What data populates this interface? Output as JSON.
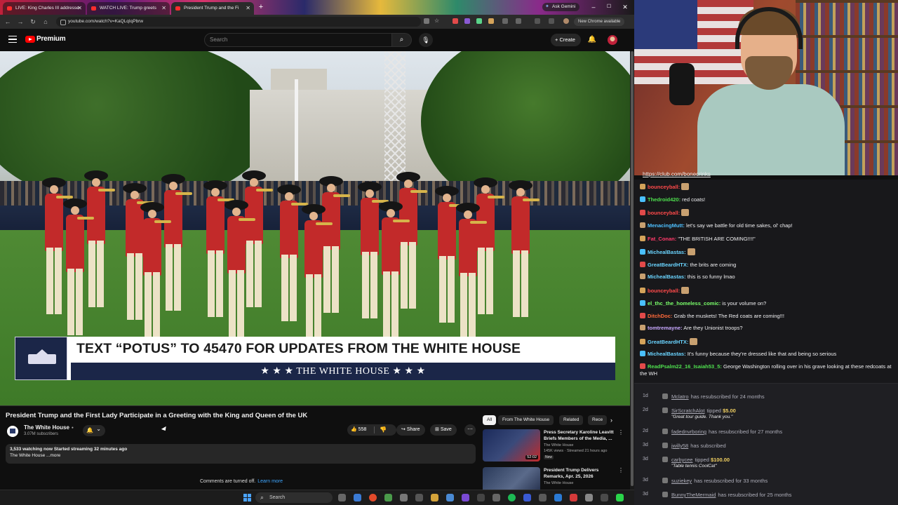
{
  "browser": {
    "tabs": [
      {
        "title": "LIVE: King Charles III addresse",
        "active": false
      },
      {
        "title": "WATCH LIVE: Trump greets",
        "active": false
      },
      {
        "title": "President Trump and the Fi",
        "active": true
      }
    ],
    "ask_gemini": "Ask Gemini",
    "url": "youtube.com/watch?v=KaQLqIqPbrw",
    "new_chrome": "New Chrome available",
    "window_controls": {
      "minimize": "–",
      "maximize": "☐",
      "close": "✕"
    }
  },
  "youtube": {
    "logo_text": "Premium",
    "search_placeholder": "Search",
    "create_label": "+ Create",
    "video": {
      "lower_third_main": "TEXT “POTUS” TO 45470 FOR UPDATES FROM THE WHITE HOUSE",
      "lower_third_bar": "★ ★ ★   THE WHITE HOUSE   ★ ★ ★"
    },
    "title": "President Trump and the First Lady Participate in a Greeting with the King and Queen of the UK",
    "channel": {
      "name": "The White House",
      "subscribers": "3.07M subscribers"
    },
    "actions": {
      "likes": "558",
      "share": "Share",
      "save": "Save",
      "more": "⋯"
    },
    "description": {
      "stats": "3,533 watching now  Started streaming 32 minutes ago",
      "preview": "The White House ...more"
    },
    "comments": {
      "text": "Comments are turned off.",
      "link": "Learn more"
    },
    "chips": [
      "All",
      "From The White House",
      "Related",
      "Rece"
    ],
    "recommendations": [
      {
        "title": "Press Secretary Karoline Leavitt Briefs Members of the Media, ...",
        "channel": "The White House",
        "meta": "145K views · Streamed 21 hours ago",
        "badge": "New",
        "duration": "52:02"
      },
      {
        "title": "President Trump Delivers Remarks, Apr. 25, 2026",
        "channel": "The White House",
        "meta": "",
        "badge": "",
        "duration": ""
      }
    ]
  },
  "stream": {
    "chat_link": "https://club.com/bonecrinks",
    "chat": [
      {
        "user": "bounceyball:",
        "text": "",
        "color": "#ff4a4a",
        "emote": true
      },
      {
        "user": "Thedroid420:",
        "text": " red coats!",
        "color": "#4ee04e",
        "emote": false
      },
      {
        "user": "bounceyball:",
        "text": "",
        "color": "#ff4a4a",
        "emote": true
      },
      {
        "user": "MenacingMutt:",
        "text": " let's say we battle for old time sakes, ol' chap!",
        "color": "#4ec0ff",
        "emote": false
      },
      {
        "user": "Fat_Conan:",
        "text": " \"THE BRITISH ARE COMING!!!!\"",
        "color": "#ff3a6a",
        "emote": false
      },
      {
        "user": "MichealBastas:",
        "text": "",
        "color": "#6ad4ff",
        "emote": true
      },
      {
        "user": "GreatBeardHTX:",
        "text": " the brits are coming",
        "color": "#6ad4ff",
        "emote": false
      },
      {
        "user": "MichealBastas:",
        "text": " this is so funny lmao",
        "color": "#6ad4ff",
        "emote": false
      },
      {
        "user": "bounceyball:",
        "text": "",
        "color": "#ff4a4a",
        "emote": true
      },
      {
        "user": "el_thc_the_homeless_comic:",
        "text": " is your volume on?",
        "color": "#7aff6a",
        "emote": false
      },
      {
        "user": "DitchDoc:",
        "text": " Grab the muskets! The Red coats are coming!!!",
        "color": "#ff6a3a",
        "emote": false
      },
      {
        "user": "tomtremayne:",
        "text": " Are they Unionist troops?",
        "color": "#c8a8ff",
        "emote": false
      },
      {
        "user": "GreatBeardHTX:",
        "text": "",
        "color": "#6ad4ff",
        "emote": true
      },
      {
        "user": "MichealBastas:",
        "text": " It's funny because they're dressed like that and being so serious",
        "color": "#6ad4ff",
        "emote": false
      },
      {
        "user": "ReadPsalm22_16_Isaiah53_5:",
        "text": " George Washington rolling over in his grave looking at these redcoats at the WH",
        "color": "#4ee04e",
        "emote": false
      }
    ],
    "events": [
      {
        "age": "1d",
        "name": "Mclatro",
        "text": "has resubscribed for 24 months",
        "amount": "",
        "note": ""
      },
      {
        "age": "2d",
        "name": "SirScratchAlot",
        "text": "tipped",
        "amount": "$5.00",
        "note": "\"Great tour guide. Thank you.\""
      },
      {
        "age": "2d",
        "name": "fadednvrboring",
        "text": "has resubscribed for 27 months",
        "amount": "",
        "note": ""
      },
      {
        "age": "3d",
        "name": "jwilly58",
        "text": "has subscribed",
        "amount": "",
        "note": ""
      },
      {
        "age": "3d",
        "name": "carbycee",
        "text": "tipped",
        "amount": "$100.00",
        "note": "\"Table tennis CoolCat\""
      },
      {
        "age": "3d",
        "name": "suziekey",
        "text": "has resubscribed for 33 months",
        "amount": "",
        "note": ""
      },
      {
        "age": "3d",
        "name": "BunnyTheMermaid",
        "text": "has resubscribed for 25 months",
        "amount": "",
        "note": ""
      }
    ]
  },
  "taskbar": {
    "search_placeholder": "Search"
  }
}
